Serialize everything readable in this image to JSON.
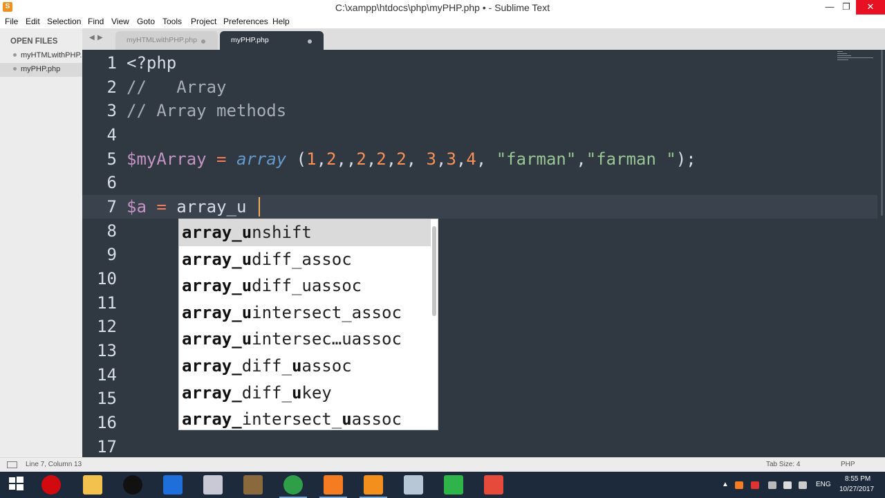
{
  "window": {
    "title": "C:\\xampp\\htdocs\\php\\myPHP.php • - Sublime Text",
    "minimize_glyph": "—",
    "maximize_glyph": "❐",
    "close_glyph": "✕",
    "app_icon_letter": "S"
  },
  "menu": [
    "File",
    "Edit",
    "Selection",
    "Find",
    "View",
    "Goto",
    "Tools",
    "Project",
    "Preferences",
    "Help"
  ],
  "sidebar": {
    "header": "OPEN FILES",
    "files": [
      {
        "name": "myHTMLwithPHP.php"
      },
      {
        "name": "myPHP.php"
      }
    ]
  },
  "tabs": [
    {
      "label": "myHTMLwithPHP.php",
      "active": false
    },
    {
      "label": "myPHP.php",
      "active": true
    }
  ],
  "tab_nav": {
    "left": "◀",
    "right": "▶"
  },
  "editor": {
    "line_numbers": [
      "1",
      "2",
      "3",
      "4",
      "5",
      "6",
      "7",
      "8",
      "9",
      "10",
      "11",
      "12",
      "13",
      "14",
      "15",
      "16",
      "17"
    ],
    "lines": {
      "l1": "<?php",
      "l2": "//   Array",
      "l3": "// Array methods",
      "l5_var": "$myArray",
      "l5_eq": " = ",
      "l5_func": "array",
      "l5_open": " (",
      "l5_args": [
        "1",
        ",",
        "2",
        ",,",
        "2",
        ",",
        "2",
        ",",
        "2",
        ", ",
        "3",
        ",",
        "3",
        ",",
        "4",
        ", "
      ],
      "l5_str1": "\"farman\"",
      "l5_comma": ",",
      "l5_str2": "\"farman \"",
      "l5_close": ");",
      "l7_var": "$a",
      "l7_eq": " = ",
      "l7_text": "array_u"
    },
    "current_line": 7,
    "language_colors": {
      "background": "#303841",
      "comment": "#a7adba",
      "variable": "#c594c5",
      "operator": "#f97b58",
      "function": "#6699cc",
      "number": "#f99157",
      "string": "#99c794"
    }
  },
  "autocomplete": {
    "typed_prefix": "array_u",
    "items": [
      {
        "parts": [
          [
            "array_u",
            true
          ],
          [
            "nshift",
            false
          ]
        ],
        "selected": true
      },
      {
        "parts": [
          [
            "array_u",
            true
          ],
          [
            "diff_assoc",
            false
          ]
        ],
        "selected": false
      },
      {
        "parts": [
          [
            "array_u",
            true
          ],
          [
            "diff_uassoc",
            false
          ]
        ],
        "selected": false
      },
      {
        "parts": [
          [
            "array_u",
            true
          ],
          [
            "intersect_assoc",
            false
          ]
        ],
        "selected": false
      },
      {
        "parts": [
          [
            "array_u",
            true
          ],
          [
            "intersec…uassoc",
            false
          ]
        ],
        "selected": false
      },
      {
        "parts": [
          [
            "array_",
            true
          ],
          [
            "diff_",
            false
          ],
          [
            "u",
            true
          ],
          [
            "assoc",
            false
          ]
        ],
        "selected": false
      },
      {
        "parts": [
          [
            "array_",
            true
          ],
          [
            "diff_",
            false
          ],
          [
            "u",
            true
          ],
          [
            "key",
            false
          ]
        ],
        "selected": false
      },
      {
        "parts": [
          [
            "array_",
            true
          ],
          [
            "intersect_",
            false
          ],
          [
            "u",
            true
          ],
          [
            "assoc",
            false
          ]
        ],
        "selected": false
      }
    ]
  },
  "status": {
    "position": "Line 7, Column 13",
    "tab_size": "Tab Size: 4",
    "syntax": "PHP"
  },
  "taskbar": {
    "language": "ENG",
    "time": "8:55 PM",
    "date": "10/27/2017",
    "apps": [
      "start-icon",
      "opera-icon",
      "file-explorer-icon",
      "github-icon",
      "outlook-icon",
      "paint-icon",
      "winrar-icon",
      "chrome-icon",
      "xampp-icon",
      "sublime-icon",
      "network-icon",
      "camtasia-icon",
      "camtasia-recorder-icon"
    ]
  }
}
